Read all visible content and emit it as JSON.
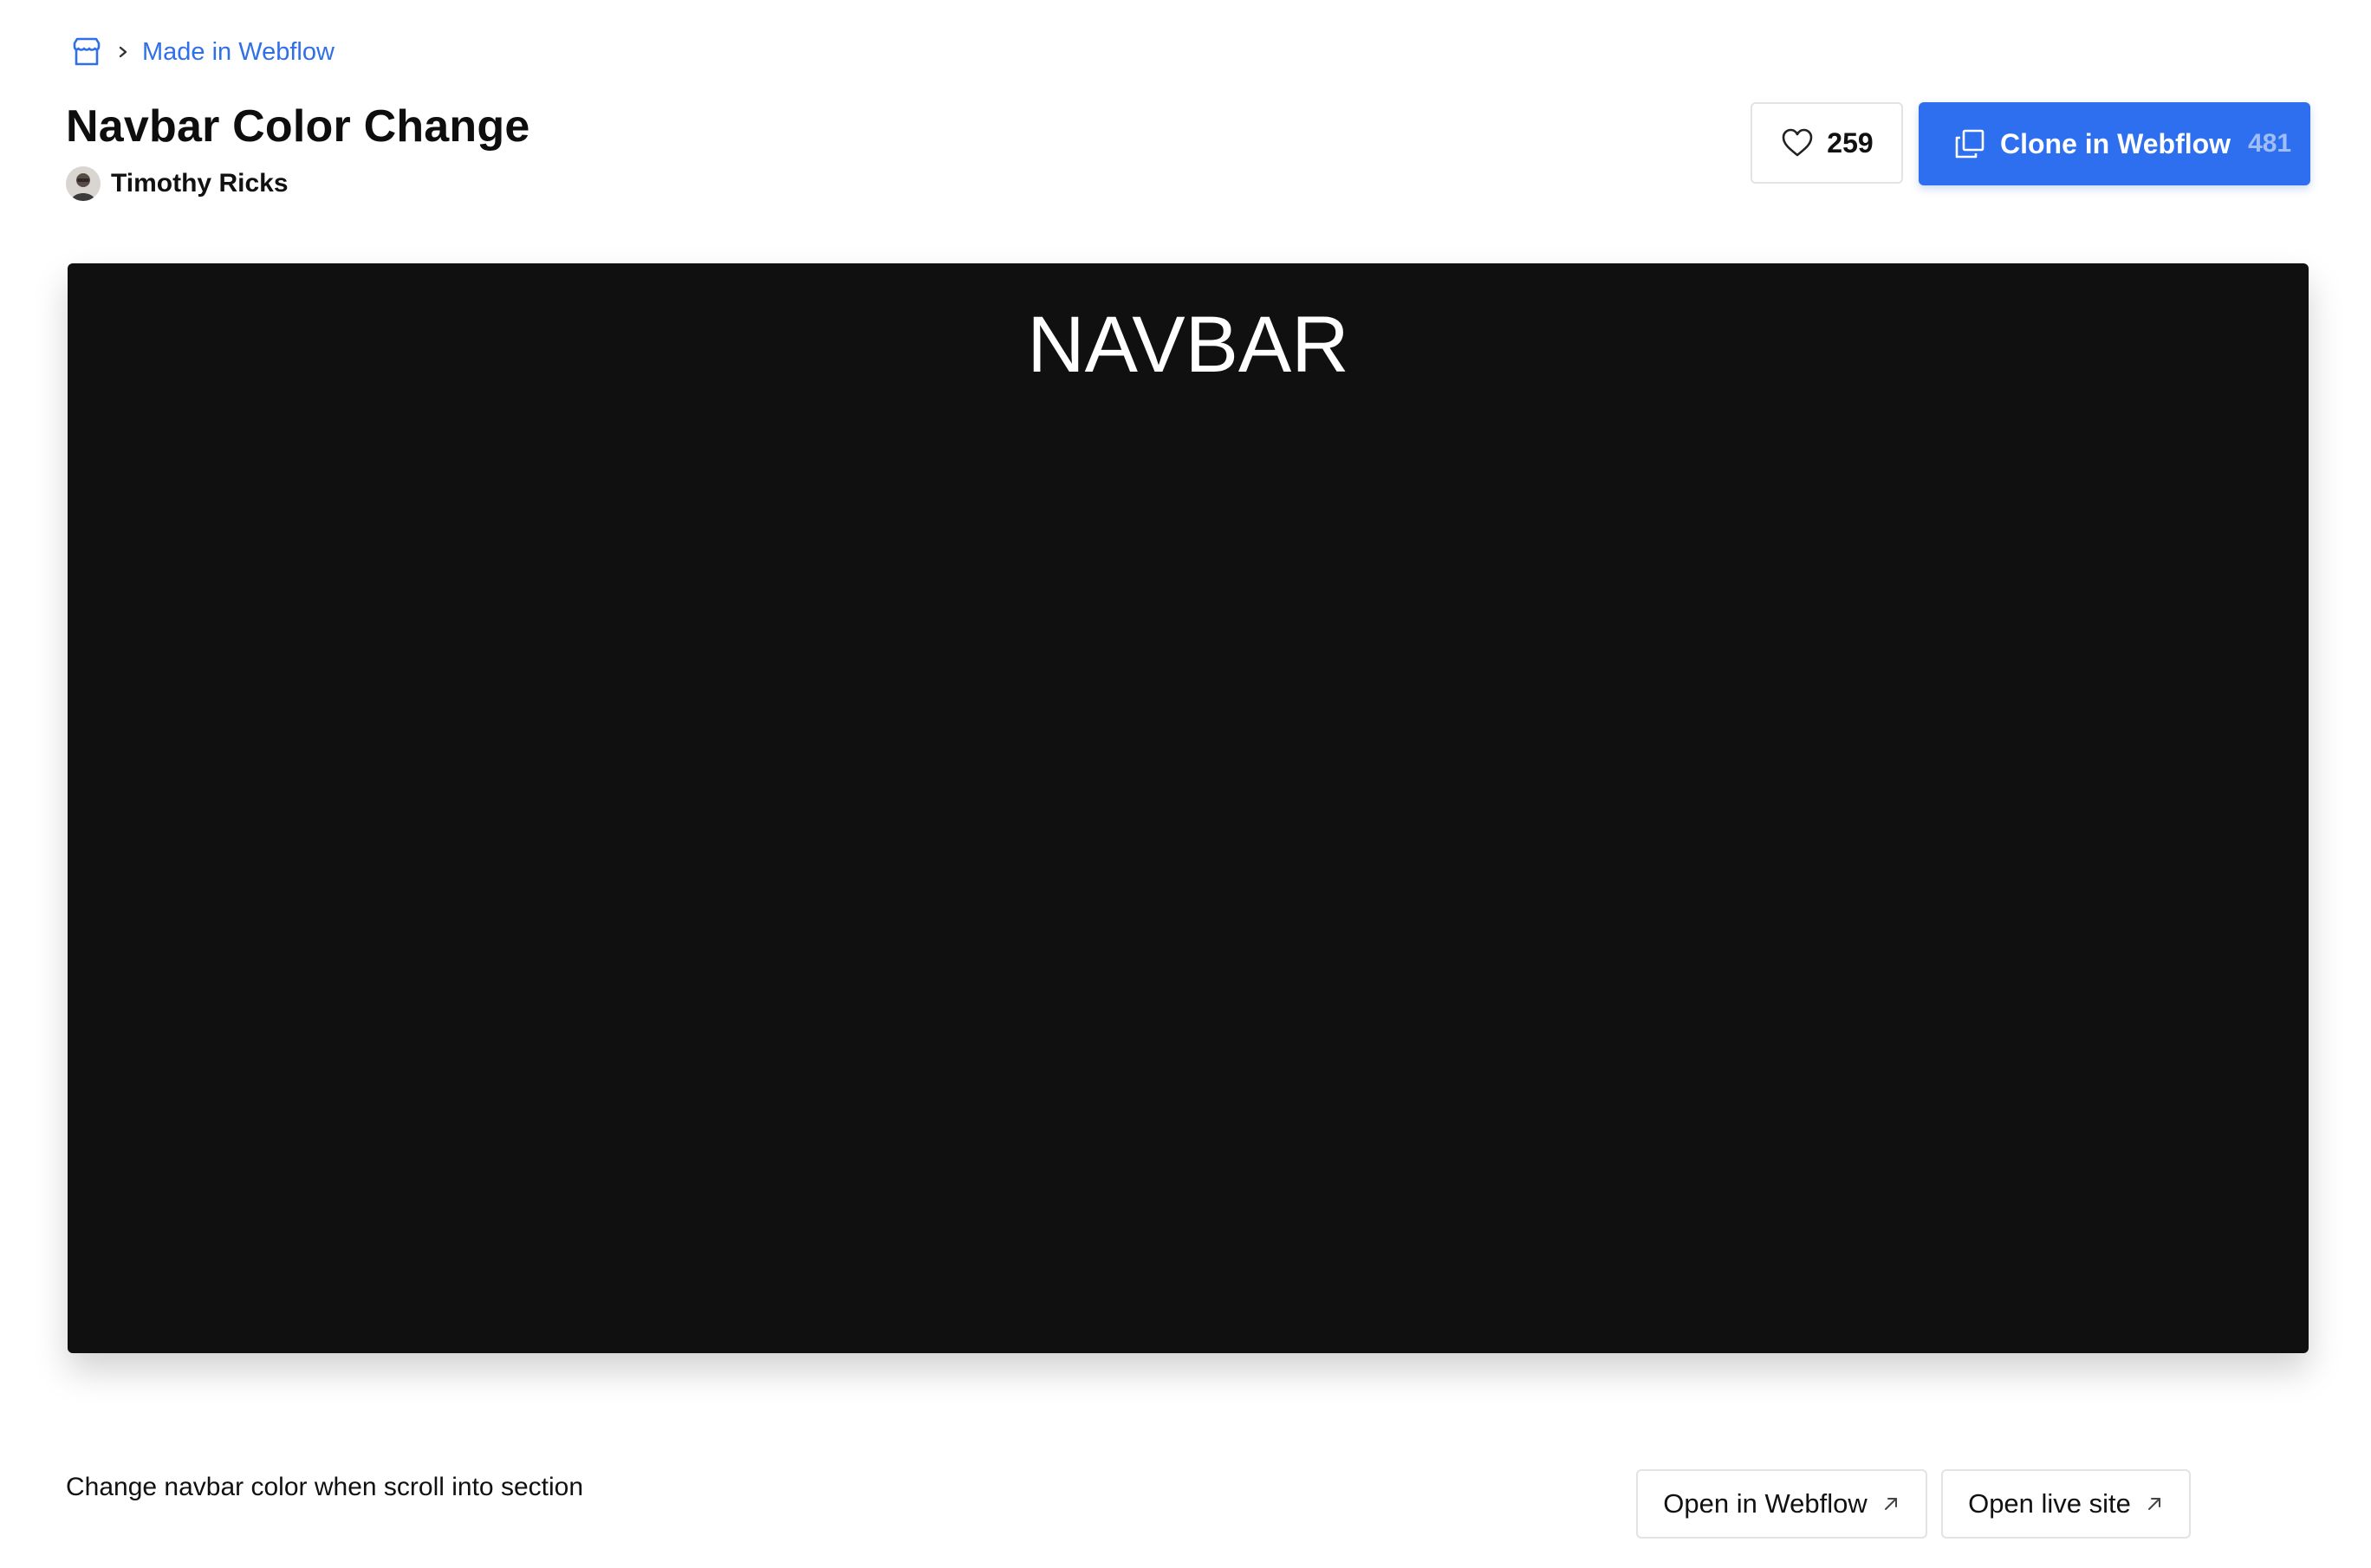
{
  "breadcrumb": {
    "icon": "store-icon",
    "separator_icon": "chevron-right-icon",
    "link_label": "Made in Webflow"
  },
  "project": {
    "title": "Navbar Color Change",
    "author": "Timothy Ricks",
    "description": "Change navbar color when scroll into section"
  },
  "actions": {
    "like_count": "259",
    "clone_label": "Clone in Webflow",
    "clone_count": "481",
    "open_webflow_label": "Open in Webflow",
    "open_live_label": "Open live site"
  },
  "preview": {
    "nav_text": "NAVBAR"
  },
  "colors": {
    "accent": "#2e6ff0",
    "link": "#2f6fe8",
    "preview_bg": "#101010"
  }
}
